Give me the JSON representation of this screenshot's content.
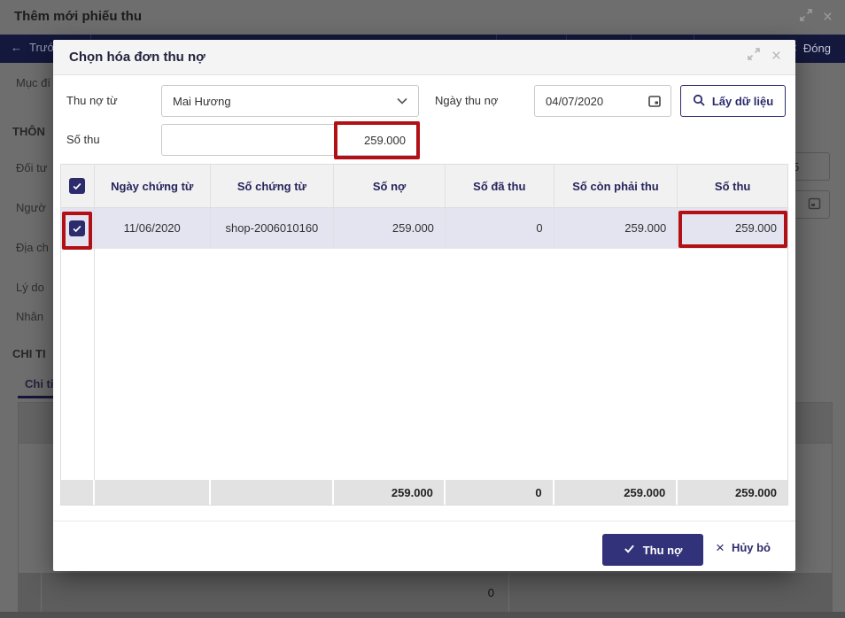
{
  "window": {
    "title": "Thêm mới phiếu thu"
  },
  "toolbar": {
    "back": "Trước",
    "close": "Đóng"
  },
  "background": {
    "labels": [
      "Mục đí",
      "THÔN",
      "Đối tư",
      "Ngườ",
      "Địa ch",
      "Lý do",
      "Nhân",
      "CHI TI"
    ],
    "tab": "Chi ti",
    "partial_input_value": "5",
    "footer_total": "0"
  },
  "modal": {
    "title": "Chọn hóa đơn thu nợ",
    "form": {
      "payer_label": "Thu nợ từ",
      "payer_value": "Mai Hương",
      "date_label": "Ngày thu nợ",
      "date_value": "04/07/2020",
      "fetch_button": "Lấy dữ liệu",
      "amount_label": "Số thu",
      "amount_value": "259.000"
    },
    "table": {
      "headers": [
        "Ngày chứng từ",
        "Số chứng từ",
        "Số nợ",
        "Số đã thu",
        "Số còn phải thu",
        "Số thu"
      ],
      "row": {
        "date": "11/06/2020",
        "doc_no": "shop-2006010160",
        "debt": "259.000",
        "collected": "0",
        "remaining": "259.000",
        "amount": "259.000"
      },
      "totals": {
        "debt": "259.000",
        "collected": "0",
        "remaining": "259.000",
        "amount": "259.000"
      }
    },
    "actions": {
      "submit": "Thu nợ",
      "cancel": "Hủy bỏ"
    }
  },
  "colors": {
    "accent": "#2b2b6e",
    "button": "#32327a",
    "annotation": "#b11116",
    "row_selected": "#e4e4f1",
    "toolbar": "#14183c"
  }
}
